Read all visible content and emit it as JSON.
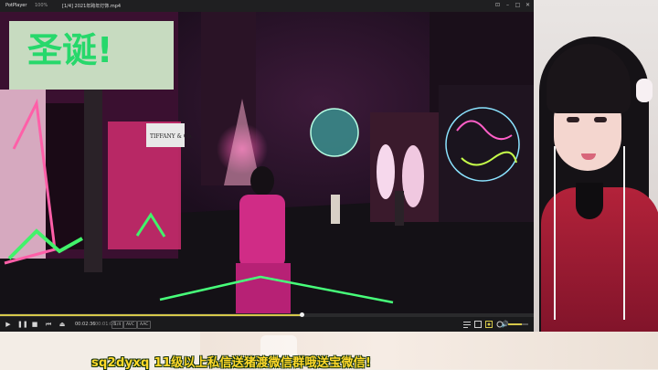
{
  "player": {
    "app_name": "PotPlayer",
    "menu_label": "100%",
    "file_title": "[1/4] 2021年跨年灯饰.mp4",
    "window_buttons": {
      "pin": "⊡",
      "minimize": "–",
      "maximize": "□",
      "close": "✕"
    }
  },
  "video": {
    "store_sign_top": "TIFFANY & CO.",
    "store_sign": "TIFFANY & Co."
  },
  "controls": {
    "play": "▶",
    "pause": "❚❚",
    "stop": "■",
    "prev": "⏮",
    "next": "⏭",
    "eject": "⏏",
    "elapsed": "00:02:36",
    "duration": "00:01:08",
    "format_tags": [
      "1/4",
      "AVC",
      "AAC"
    ],
    "right_icons": [
      "playlist-icon",
      "subtitle-icon",
      "capture-icon",
      "settings-icon",
      "menu-icon"
    ],
    "volume_icon": "🔊",
    "progress_fraction": 0.565,
    "volume_fraction": 0.7,
    "accent": "#d6c84a"
  },
  "overlay": {
    "ticker": "sq2dyxq   11级以上私信送猪渡微信群哦送宝微信!"
  }
}
